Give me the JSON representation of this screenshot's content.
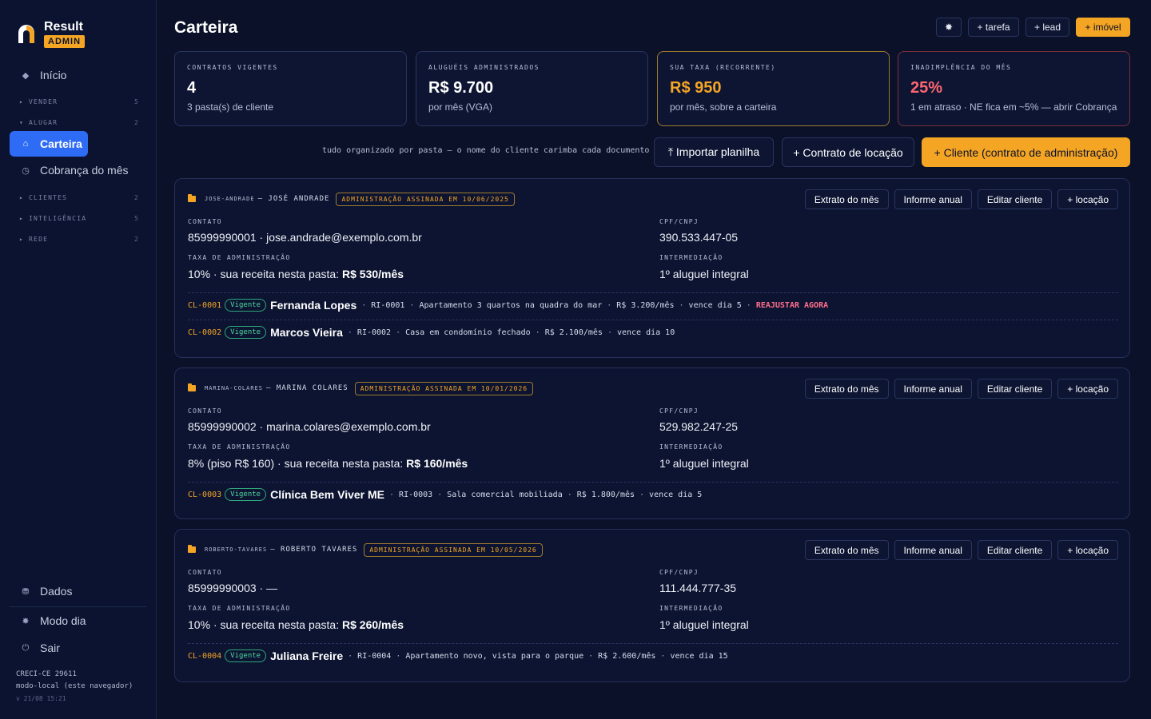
{
  "brand": {
    "title": "Result",
    "badge": "ADMIN"
  },
  "sidebar": {
    "inicio": "Início",
    "groups": [
      {
        "label": "▸ VENDER",
        "count": "5"
      },
      {
        "label": "▾ ALUGAR",
        "count": "2"
      },
      {
        "label": "▸ CLIENTES",
        "count": "2"
      },
      {
        "label": "▸ INTELIGÊNCIA",
        "count": "5"
      },
      {
        "label": "▸ REDE",
        "count": "2"
      }
    ],
    "carteira": "Carteira",
    "cobranca": "Cobrança do mês",
    "dados": "Dados",
    "modo": "Modo dia",
    "sair": "Sair",
    "footer": {
      "creci": "CRECI-CE 29611",
      "mode": "modo-local (este navegador)",
      "version": "v 21/08 15:21"
    }
  },
  "header": {
    "title": "Carteira",
    "buttons": {
      "theme": "✸",
      "tarefa": "+ tarefa",
      "lead": "+ lead",
      "imovel": "+ imóvel"
    }
  },
  "kpis": [
    {
      "label": "CONTRATOS VIGENTES",
      "value": "4",
      "sub": "3 pasta(s) de cliente"
    },
    {
      "label": "ALUGUÉIS ADMINISTRADOS",
      "value": "R$ 9.700",
      "sub": "por mês (VGA)"
    },
    {
      "label": "SUA TAXA (RECORRENTE)",
      "value": "R$ 950",
      "sub": "por mês, sobre a carteira"
    },
    {
      "label": "INADIMPLÊNCIA DO MÊS",
      "value": "25%",
      "sub": "1 em atraso · NE fica em ~5% — abrir Cobrança"
    }
  ],
  "actions": {
    "hint": "tudo organizado por pasta — o nome do cliente carimba cada documento",
    "importar": "⤒ Importar planilha",
    "contrato": "+ Contrato de locação",
    "cliente": "+ Cliente (contrato de administração)"
  },
  "card_buttons": {
    "extrato": "Extrato do mês",
    "informe": "Informe anual",
    "editar": "Editar cliente",
    "locacao": "+ locação"
  },
  "labels": {
    "contato": "CONTATO",
    "cpf": "CPF/CNPJ",
    "taxa": "TAXA DE ADMINISTRAÇÃO",
    "inter": "INTERMEDIAÇÃO"
  },
  "clients": [
    {
      "slug": "JOSE-ANDRADE",
      "name": "— JOSÉ ANDRADE",
      "badge": "ADMINISTRAÇÃO ASSINADA EM 10/06/2025",
      "contato": "85999990001 · jose.andrade@exemplo.com.br",
      "cpf": "390.533.447-05",
      "taxa_pre": "10% · sua receita nesta pasta:",
      "taxa_val": "R$ 530/mês",
      "inter": "1º aluguel integral",
      "contracts": [
        {
          "code": "CL-0001",
          "status": "Vigente",
          "tenant": "Fernanda Lopes",
          "ri": "RI-0001",
          "desc": "Apartamento 3 quartos na quadra do mar",
          "rent": "R$ 3.200/mês",
          "due": "vence dia 5",
          "alert": "REAJUSTAR AGORA"
        },
        {
          "code": "CL-0002",
          "status": "Vigente",
          "tenant": "Marcos Vieira",
          "ri": "RI-0002",
          "desc": "Casa em condomínio fechado",
          "rent": "R$ 2.100/mês",
          "due": "vence dia 10"
        }
      ]
    },
    {
      "slug": "MARINA-COLARES",
      "name": "— MARINA COLARES",
      "badge": "ADMINISTRAÇÃO ASSINADA EM 10/01/2026",
      "contato": "85999990002 · marina.colares@exemplo.com.br",
      "cpf": "529.982.247-25",
      "taxa_pre": "8% (piso R$ 160) · sua receita nesta pasta:",
      "taxa_val": "R$ 160/mês",
      "inter": "1º aluguel integral",
      "contracts": [
        {
          "code": "CL-0003",
          "status": "Vigente",
          "tenant": "Clínica Bem Viver ME",
          "ri": "RI-0003",
          "desc": "Sala comercial mobiliada",
          "rent": "R$ 1.800/mês",
          "due": "vence dia 5"
        }
      ]
    },
    {
      "slug": "ROBERTO-TAVARES",
      "name": "— ROBERTO TAVARES",
      "badge": "ADMINISTRAÇÃO ASSINADA EM 10/05/2026",
      "contato": "85999990003 · —",
      "cpf": "111.444.777-35",
      "taxa_pre": "10% · sua receita nesta pasta:",
      "taxa_val": "R$ 260/mês",
      "inter": "1º aluguel integral",
      "contracts": [
        {
          "code": "CL-0004",
          "status": "Vigente",
          "tenant": "Juliana Freire",
          "ri": "RI-0004",
          "desc": "Apartamento novo, vista para o parque",
          "rent": "R$ 2.600/mês",
          "due": "vence dia 15"
        }
      ]
    }
  ]
}
